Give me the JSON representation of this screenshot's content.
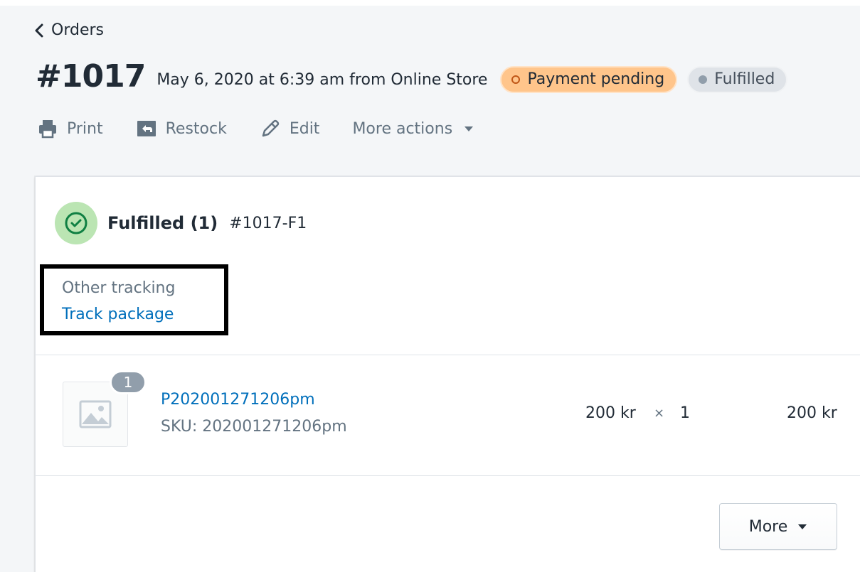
{
  "nav": {
    "back_label": "Orders"
  },
  "order": {
    "number": "#1017",
    "meta": "May 6, 2020 at 6:39 am from Online Store",
    "payment_status": "Payment pending",
    "fulfillment_status": "Fulfilled"
  },
  "actions": {
    "print": "Print",
    "restock": "Restock",
    "edit": "Edit",
    "more_actions": "More actions"
  },
  "fulfillment": {
    "title": "Fulfilled (1)",
    "id": "#1017-F1",
    "tracking_label": "Other tracking",
    "track_link": "Track package"
  },
  "line_item": {
    "quantity_badge": "1",
    "title": "P202001271206pm",
    "sku": "SKU: 202001271206pm",
    "price": "200 kr",
    "times": "×",
    "quantity": "1",
    "total": "200 kr"
  },
  "footer": {
    "more_label": "More"
  },
  "colors": {
    "link": "#006fbb",
    "pending_badge": "#ffc58b",
    "fulfilled_badge": "#dfe3e8",
    "success_circle": "#bbe5b3",
    "success_icon": "#108043"
  },
  "icons": [
    "chevron-left-icon",
    "print-icon",
    "restock-icon",
    "edit-pencil-icon",
    "caret-down-icon",
    "check-circle-icon",
    "image-placeholder-icon"
  ]
}
